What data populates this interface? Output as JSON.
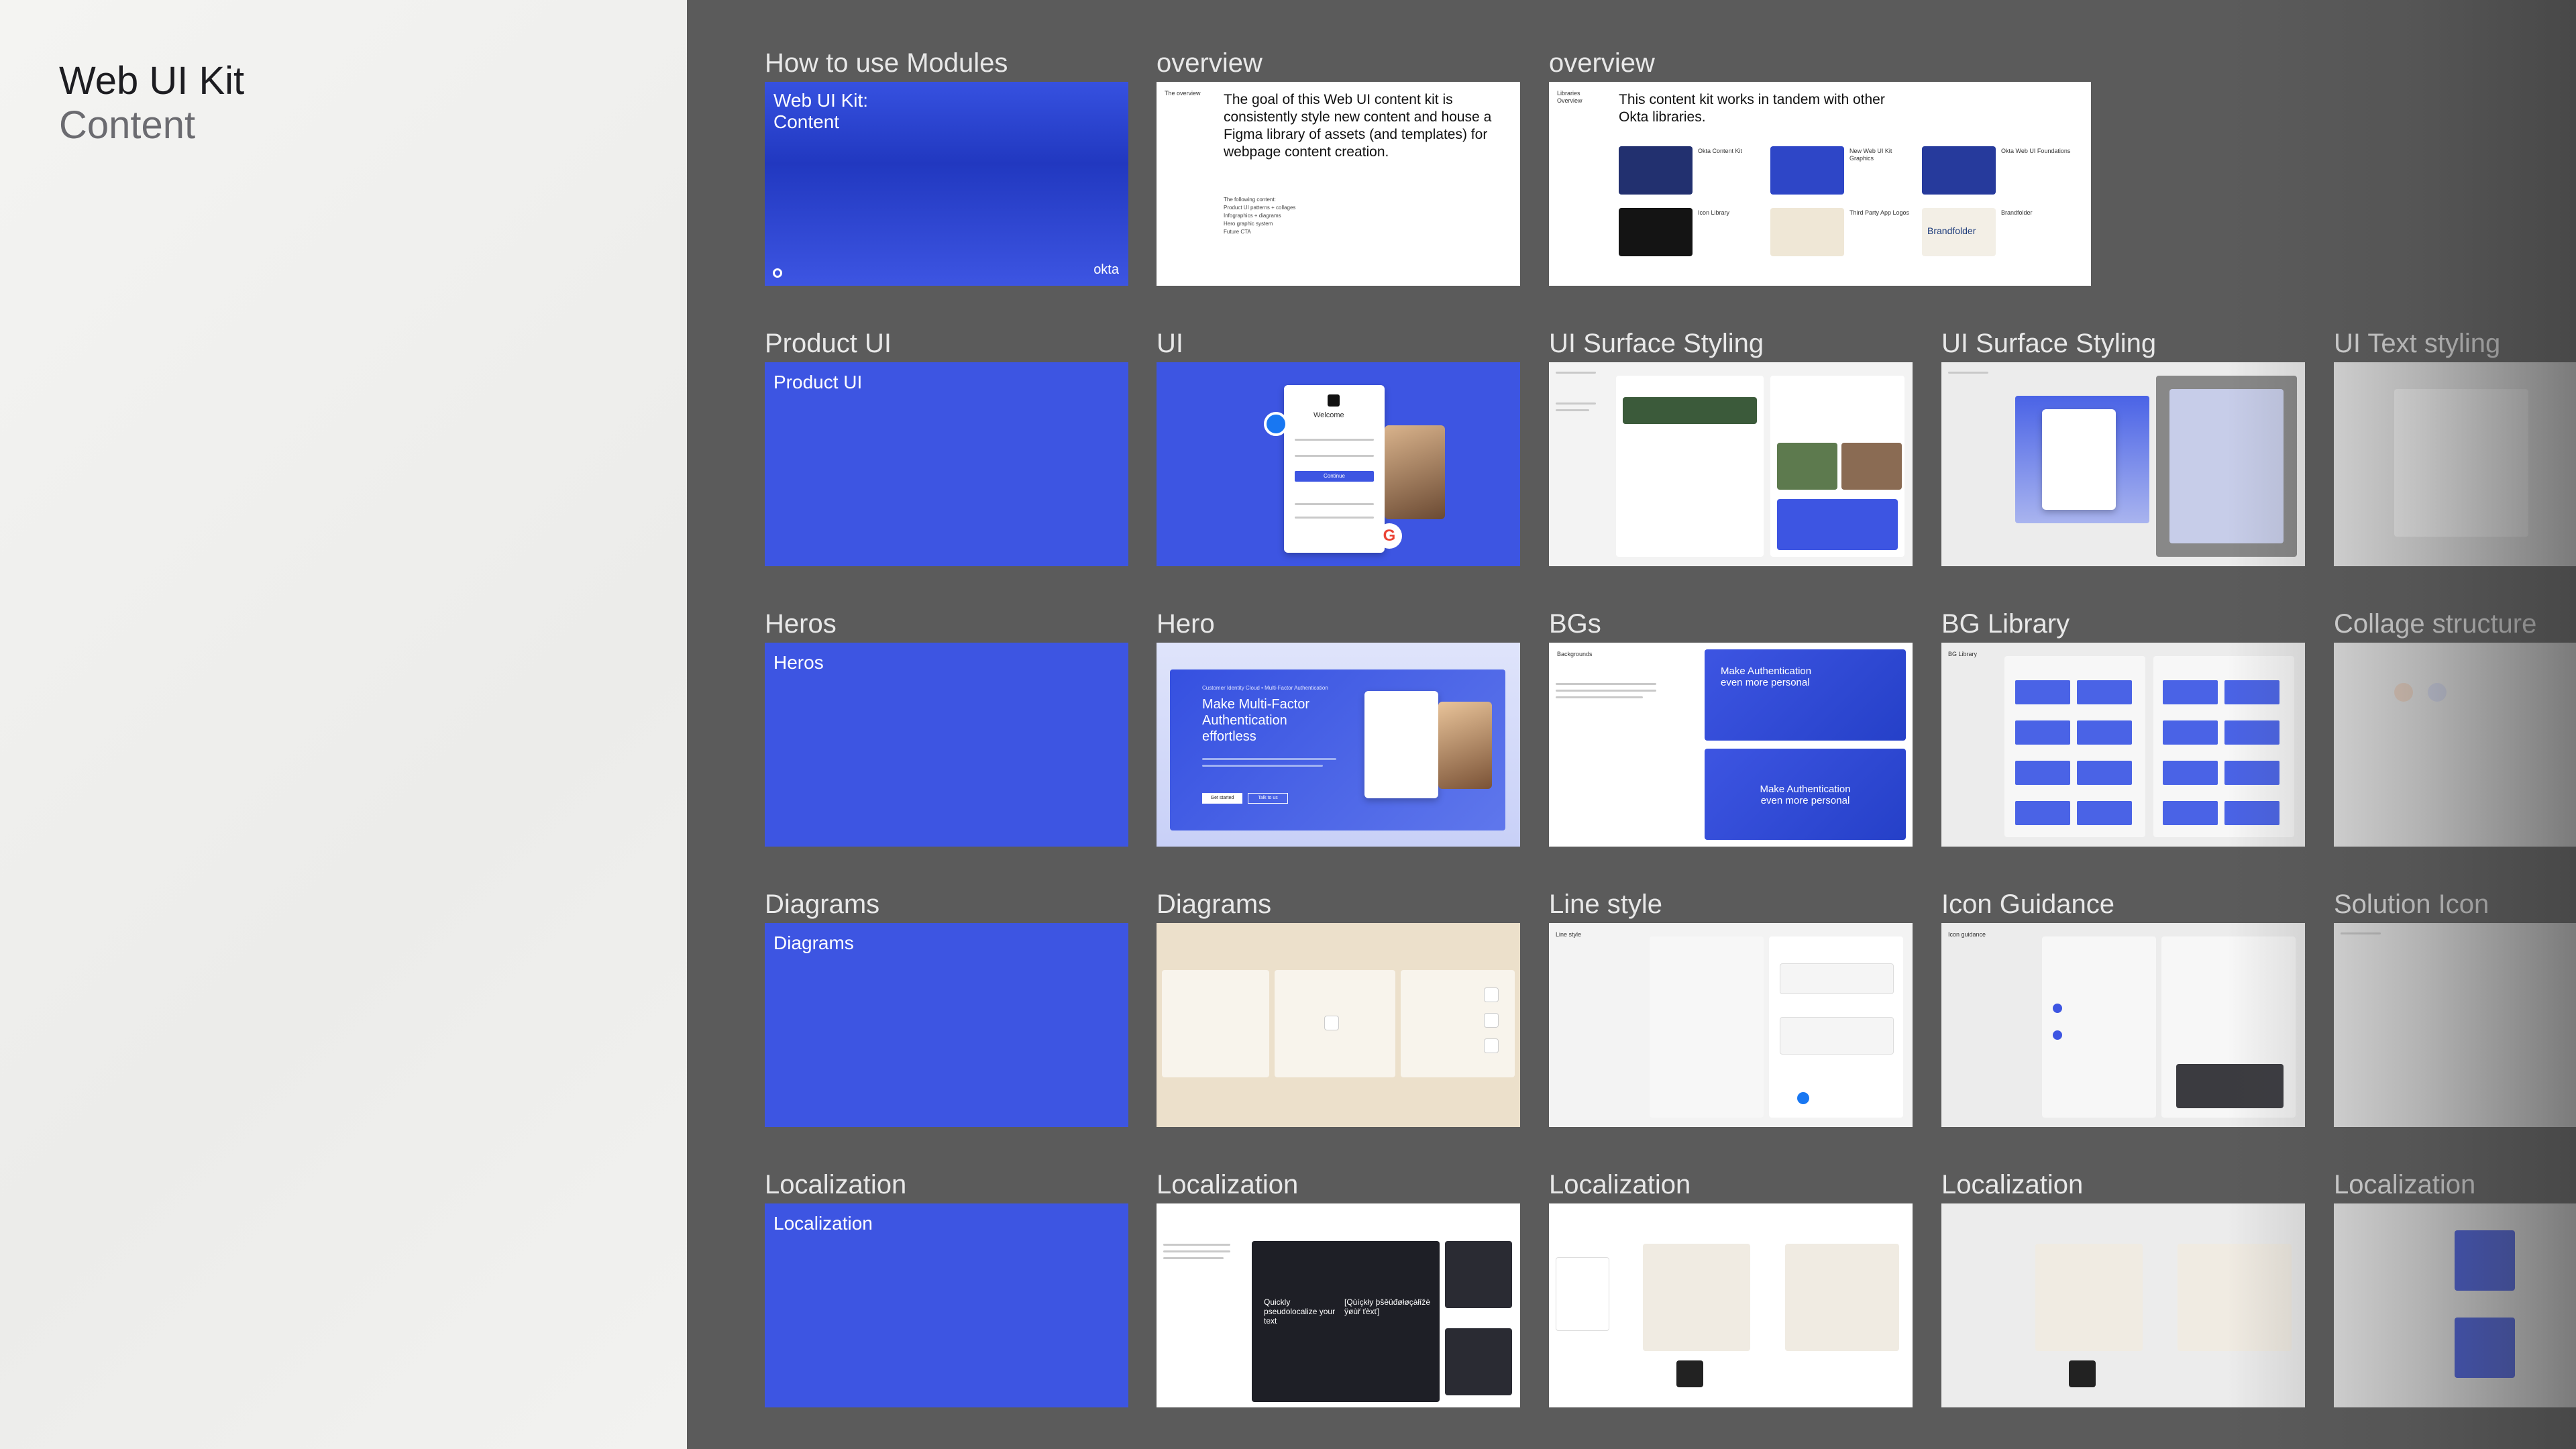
{
  "sidebar": {
    "title": "Web UI Kit",
    "subtitle": "Content"
  },
  "rows": [
    {
      "labels": [
        "How to use Modules",
        "overview",
        "overview"
      ],
      "cover": {
        "title_line1": "Web UI Kit:",
        "title_line2": "Content",
        "logo": "okta"
      },
      "overview1": {
        "tag": "The overview",
        "body": "The goal of this Web UI content kit is consistently style new content and house a Figma library of assets (and templates) for webpage content creation.",
        "bullets_heading": "The following content:",
        "bullets": [
          "Product UI patterns + collages",
          "Infographics + diagrams",
          "Hero graphic system",
          "Future CTA"
        ]
      },
      "overview2": {
        "tag": "Libraries Overview",
        "body": "This content kit works in tandem with other Okta libraries.",
        "items": [
          "Okta Content Kit",
          "New Web UI Kit Graphics",
          "Okta Web UI Foundations",
          "Icon Library",
          "Third Party App Logos",
          "Brandfolder"
        ],
        "logos_label": "Third Party App Logos",
        "brandfolder": "Brandfolder"
      }
    },
    {
      "labels": [
        "Product UI",
        "UI",
        "UI Surface Styling",
        "UI Surface Styling",
        "UI Text styling"
      ],
      "section": "Product UI",
      "ui_card": {
        "welcome": "Welcome",
        "button": "Continue"
      }
    },
    {
      "labels": [
        "Heros",
        "Hero",
        "BGs",
        "BG Library",
        "Collage structure"
      ],
      "section": "Heros",
      "hero": {
        "eyebrow": "Customer Identity Cloud • Multi-Factor Authentication",
        "headline": "Make Multi-Factor Authentication effortless",
        "cta1": "Get started",
        "cta2": "Talk to us"
      },
      "bgs": {
        "tag": "Backgrounds",
        "card1": "Make Authentication even more personal",
        "card2": "Make Authentication even more personal"
      },
      "bg_library_tag": "BG Library"
    },
    {
      "labels": [
        "Diagrams",
        "Diagrams",
        "Line style",
        "Icon Guidance",
        "Solution Icon"
      ],
      "section": "Diagrams",
      "line_style_tag": "Line style",
      "icon_guidance_tag": "Icon guidance"
    },
    {
      "labels": [
        "Localization",
        "Localization",
        "Localization",
        "Localization",
        "Localization"
      ],
      "section": "Localization",
      "loc_text1": "Quickly pseudolocalize your text",
      "loc_text2": "[Qùíçkły þšěüđøłøçàłîžè ÿøùř ťèxť]"
    }
  ],
  "colors": {
    "accent_blue": "#3d55e2",
    "board_bg": "#5b5b5b",
    "sidebar_bg": "#f2f2f0"
  }
}
